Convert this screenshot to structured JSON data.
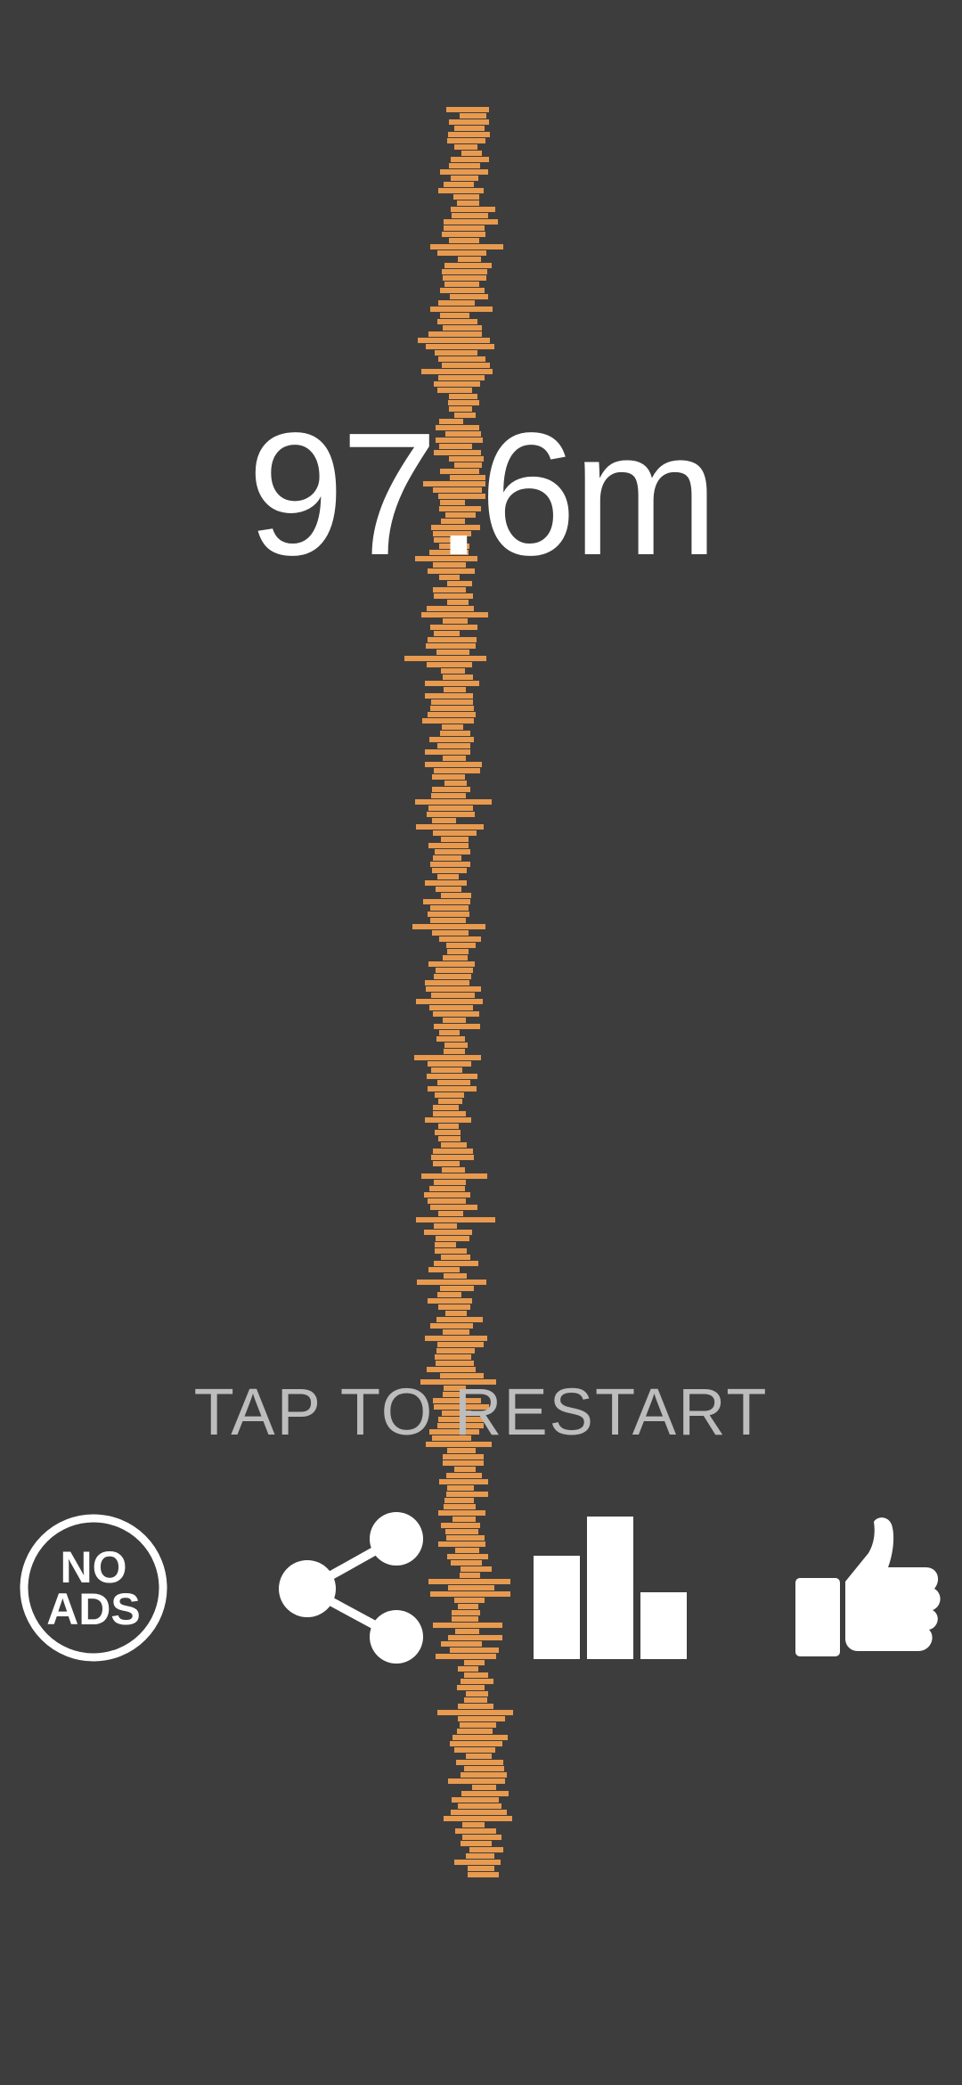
{
  "score": {
    "value": "97.6m"
  },
  "prompt": {
    "text": "TAP TO RESTART"
  },
  "buttons": {
    "no_ads": {
      "line1": "NO",
      "line2": "ADS",
      "icon": "no-ads-icon"
    },
    "share": {
      "icon": "share-icon"
    },
    "leaderboard": {
      "icon": "leaderboard-icon"
    },
    "like": {
      "icon": "thumbs-up-icon"
    }
  },
  "colors": {
    "background": "#3e3d3d",
    "tower_block": "#e89a4f",
    "text": "#ffffff",
    "prompt_text": "#bdbdbd"
  }
}
